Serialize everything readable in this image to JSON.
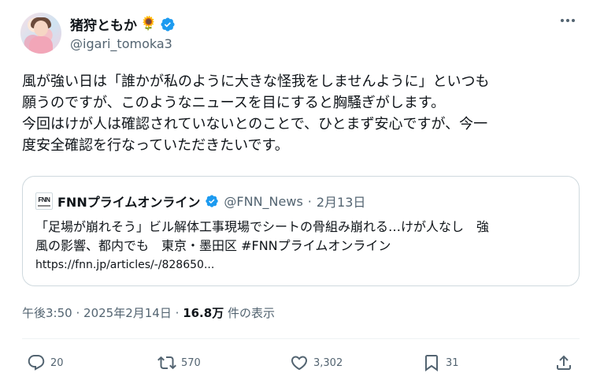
{
  "author": {
    "display_name": "猪狩ともか",
    "emoji": "🌻",
    "handle": "@igari_tomoka3"
  },
  "body_lines": [
    "風が強い日は「誰かが私のように大きな怪我をしませんように」といつも",
    "願うのですが、このようなニュースを目にすると胸騒ぎがします。",
    "今回はけが人は確認されていないとのことで、ひとまず安心ですが、今一",
    "度安全確認を行なっていただきたいです。"
  ],
  "quote": {
    "logo_text": "FNN",
    "name": "FNNプライムオンライン",
    "handle": "@FNN_News",
    "separator": "·",
    "date": "2月13日",
    "text_lines": [
      "「足場が崩れそう」ビル解体工事現場でシートの骨組み崩れる…けが人なし　強",
      "風の影響、都内でも　東京・墨田区 #FNNプライムオンライン"
    ],
    "link": "https://fnn.jp/articles/-/828650..."
  },
  "meta": {
    "time": "午後3:50",
    "sep": "·",
    "date": "2025年2月14日",
    "views": "16.8万",
    "views_label": "件の表示"
  },
  "actions": {
    "replies": "20",
    "reposts": "570",
    "likes": "3,302",
    "bookmarks": "31"
  },
  "colors": {
    "text": "#0f1419",
    "secondary": "#536471",
    "verified": "#1d9bf0",
    "border": "#cfd9de"
  }
}
